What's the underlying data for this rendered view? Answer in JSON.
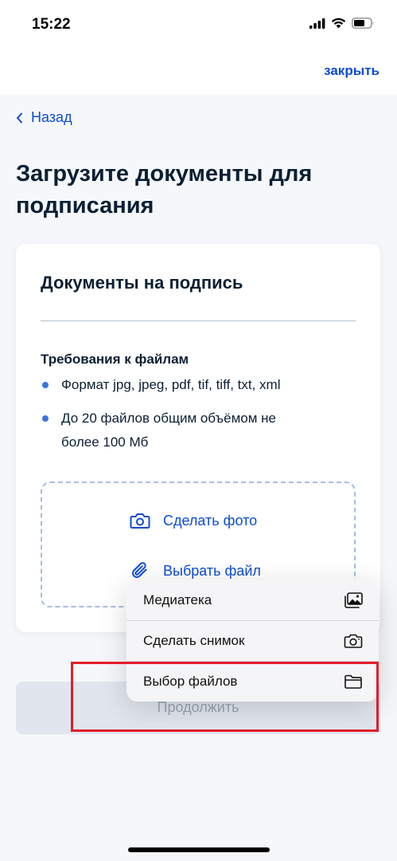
{
  "status_bar": {
    "time": "15:22"
  },
  "header": {
    "close_label": "закрыть"
  },
  "back": {
    "label": "Назад"
  },
  "page": {
    "title": "Загрузите документы для подписания"
  },
  "card": {
    "title": "Документы на подпись",
    "requirements_title": "Требования к файлам",
    "requirements": [
      "Формат jpg, jpeg, pdf, tif, tiff, txt, xml",
      "До 20 файлов общим объёмом не более 100 Мб"
    ],
    "take_photo_label": "Сделать фото",
    "choose_file_label": "Выбрать файл"
  },
  "continue_button": {
    "label": "Продолжить"
  },
  "menu": {
    "items": [
      {
        "label": "Медиатека",
        "icon": "photo-library-icon"
      },
      {
        "label": "Сделать снимок",
        "icon": "camera-icon"
      },
      {
        "label": "Выбор файлов",
        "icon": "folder-icon"
      }
    ]
  },
  "colors": {
    "accent": "#0d4cd3",
    "bullet": "#3c73e0",
    "highlight": "#e31c2b",
    "background": "#f5f7fa"
  }
}
